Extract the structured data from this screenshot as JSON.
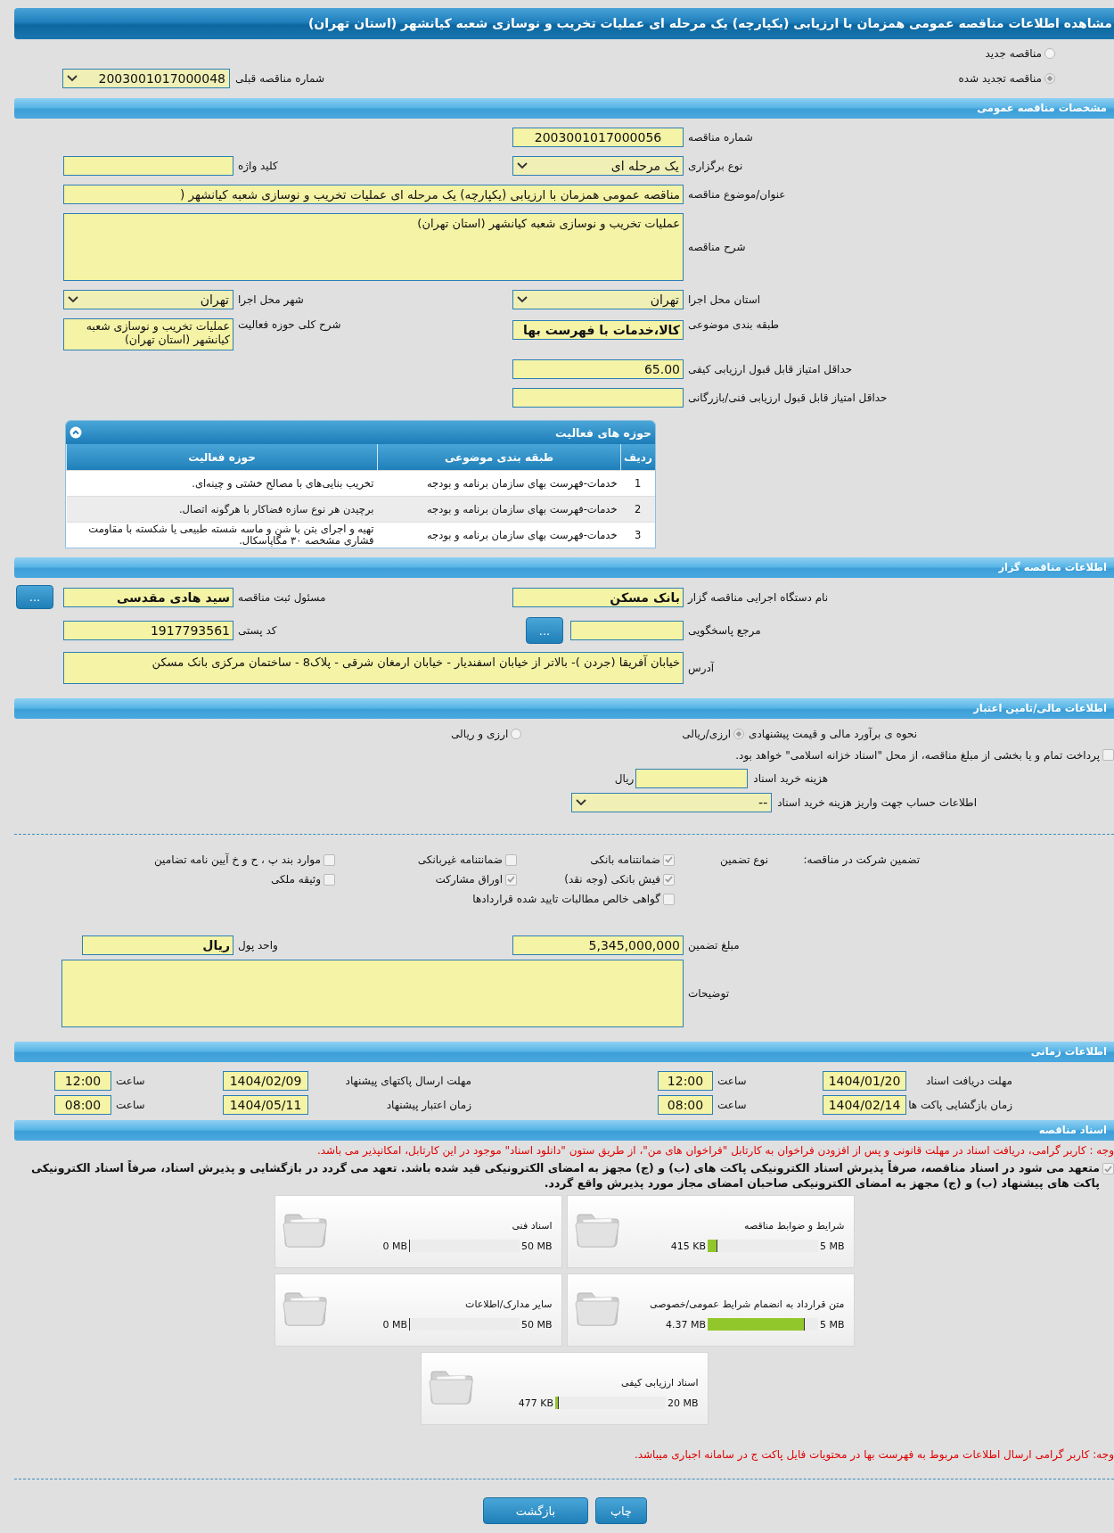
{
  "title": "مشاهده اطلاعات مناقصه عمومی همزمان با ارزیابی (یکپارچه) یک مرحله ای عملیات تخریب و نوسازی شعبه کیانشهر (استان تهران)",
  "tender_kind": [
    {
      "label": "مناقصه جدید",
      "selected": false
    },
    {
      "label": "مناقصه تجدید شده",
      "selected": true
    }
  ],
  "previous_tender": {
    "label": "شماره مناقصه قبلی",
    "value": "2003001017000048"
  },
  "general": {
    "heading": "مشخصات مناقصه عمومی",
    "tender_number": {
      "label": "شماره مناقصه",
      "value": "2003001017000056"
    },
    "holding_type": {
      "label": "نوع برگزاری",
      "value": "یک مرحله ای"
    },
    "keyword": {
      "label": "کلید واژه"
    },
    "subject": {
      "label": "عنوان/موضوع مناقصه",
      "value": "مناقصه عمومی همزمان با ارزیابی (یکپارچه) یک مرحله ای عملیات تخریب و نوسازی شعبه کیانشهر ("
    },
    "description": {
      "label": "شرح مناقصه",
      "value": "عملیات تخریب و نوسازی شعبه کیانشهر (استان تهران)"
    },
    "province": {
      "label": "استان محل اجرا",
      "value": "تهران"
    },
    "city": {
      "label": "شهر محل اجرا",
      "value": "تهران"
    },
    "category": {
      "label": "طبقه بندی موضوعی",
      "value": "کالا،خدمات با فهرست بها"
    },
    "activity_scope": {
      "label": "شرح کلی حوزه فعالیت",
      "value": "عملیات تخریب و نوسازی شعبه کیانشهر (استان تهران)"
    },
    "min_quality_score": {
      "label": "حداقل امتیاز قابل قبول ارزیابی کیفی",
      "value": "65.00"
    },
    "min_technical_score": {
      "label": "حداقل امتیاز قابل قبول ارزیابی فنی/بازرگانی"
    }
  },
  "activities": {
    "heading": "حوزه های فعالیت",
    "columns": [
      "ردیف",
      "طبقه بندی موضوعی",
      "حوزه فعالیت"
    ],
    "rows": [
      [
        "1",
        "خدمات-فهرست بهای سازمان برنامه و بودجه",
        "تخریب بنایی‌های با مصالح خشتی و چینه‌ای."
      ],
      [
        "2",
        "خدمات-فهرست بهای سازمان برنامه و بودجه",
        "برچیدن هر نوع سازه فضاکار با هرگونه اتصال."
      ],
      [
        "3",
        "خدمات-فهرست بهای سازمان برنامه و بودجه",
        "تهیه و اجرای بتن با شن و ماسه شسته طبیعی یا شکسته با مقاومت فشاری مشخصه ۳۰ مگاپاسکال."
      ]
    ]
  },
  "issuer": {
    "heading": "اطلاعات مناقصه گزار",
    "organization": {
      "label": "نام دستگاه اجرایی مناقصه گزار",
      "value": "بانک مسکن"
    },
    "registrar": {
      "label": "مسئول ثبت مناقصه",
      "value": "سید هادی مقدسی",
      "button": "..."
    },
    "reference": {
      "label": "مرجع پاسخگویی",
      "button": "..."
    },
    "postal_code": {
      "label": "کد پستی",
      "value": "1917793561"
    },
    "address": {
      "label": "آدرس",
      "value": "خیابان آفریقا (جردن )- بالاتر از خیابان اسفندیار - خیابان ارمغان شرقی - پلاک8 - ساختمان مرکزی بانک مسکن"
    }
  },
  "finance": {
    "heading": "اطلاعات مالی/تامین اعتبار",
    "estimate": {
      "label": "نحوه ی برآورد مالی و قیمت پیشنهادی",
      "options": [
        {
          "label": "ارزی/ریالی",
          "selected": true
        },
        {
          "label": "ارزی و ریالی",
          "selected": false
        }
      ]
    },
    "treasury": {
      "label": "پرداخت تمام و یا بخشی از مبلغ مناقصه، از محل \"اسناد خزانه اسلامی\" خواهد بود.",
      "checked": false
    },
    "fee": {
      "label": "هزینه خرید اسناد",
      "unit": "ریال"
    },
    "account": {
      "label": "اطلاعات حساب جهت واریز هزینه خرید اسناد",
      "value": "--"
    }
  },
  "guarantee": {
    "label": "تضمین شرکت در مناقصه:",
    "type_label": "نوع تضمین",
    "options": [
      {
        "label": "ضمانتنامه بانکی",
        "checked": true
      },
      {
        "label": "ضمانتنامه غیربانکی",
        "checked": false
      },
      {
        "label": "موارد بند پ ، ح و خ آیین نامه تضامین",
        "checked": false
      },
      {
        "label": "فیش بانکی (وجه نقد)",
        "checked": true
      },
      {
        "label": "اوراق مشارکت",
        "checked": true
      },
      {
        "label": "وثیقه ملکی",
        "checked": false
      },
      {
        "label": "گواهی خالص مطالبات تایید شده قراردادها",
        "checked": false
      }
    ],
    "amount": {
      "label": "مبلغ تضمین",
      "value": "5,345,000,000"
    },
    "currency": {
      "label": "واحد پول",
      "value": "ریال"
    },
    "notes": {
      "label": "توضیحات"
    }
  },
  "timing": {
    "heading": "اطلاعات زمانی",
    "rows": [
      {
        "label": "مهلت دریافت اسناد",
        "date": "1404/01/20",
        "time_label": "ساعت",
        "time": "12:00"
      },
      {
        "label": "مهلت ارسال پاکتهای پیشنهاد",
        "date": "1404/02/09",
        "time_label": "ساعت",
        "time": "12:00"
      },
      {
        "label": "زمان بازگشایی پاکت ها",
        "date": "1404/02/14",
        "time_label": "ساعت",
        "time": "08:00"
      },
      {
        "label": "زمان اعتبار پیشنهاد",
        "date": "1404/05/11",
        "time_label": "ساعت",
        "time": "08:00"
      }
    ]
  },
  "documents": {
    "heading": "اسناد مناقصه",
    "notice": "وجه : کاربر گرامی، دریافت اسناد در مهلت قانونی و پس از افزودن فراخوان به کارتابل \"فراخوان های من\"، از طریق ستون \"دانلود اسناد\" موجود در این کارتابل، امکانپذیر می باشد.",
    "commitment": {
      "text": "متعهد می شود در اسناد مناقصه، صرفاً پذیرش اسناد الکترونیکی پاکت های (ب) و (ج) مجهز به امضای الکترونیکی قید شده باشد. تعهد می گردد در بازگشایی و پذیرش اسناد، صرفاً اسناد الکترونیکی پاکت های پیشنهاد (ب) و (ج) مجهز به امضای الکترونیکی صاحبان امضای مجاز مورد پذیرش واقع گردد.",
      "checked": true
    },
    "files": [
      {
        "title": "شرایط و ضوابط مناقصه",
        "used": "415 KB",
        "max": "5 MB",
        "level": 0.08
      },
      {
        "title": "اسناد فنی",
        "used": "0 MB",
        "max": "50 MB",
        "level": 0
      },
      {
        "title": "متن قرارداد به انضمام شرایط عمومی/خصوصی",
        "used": "4.37 MB",
        "max": "5 MB",
        "level": 0.874
      },
      {
        "title": "سایر مدارک/اطلاعات",
        "used": "0 MB",
        "max": "50 MB",
        "level": 0
      },
      {
        "title": "اسناد ارزیابی کیفی",
        "used": "477 KB",
        "max": "20 MB",
        "level": 0.023
      }
    ],
    "footer_notice": "وجه: کاربر گرامی ارسال اطلاعات مربوط به فهرست بها در محتویات فایل پاکت ج در سامانه اجباری میباشد."
  },
  "buttons": [
    "چاپ",
    "بازگشت"
  ]
}
